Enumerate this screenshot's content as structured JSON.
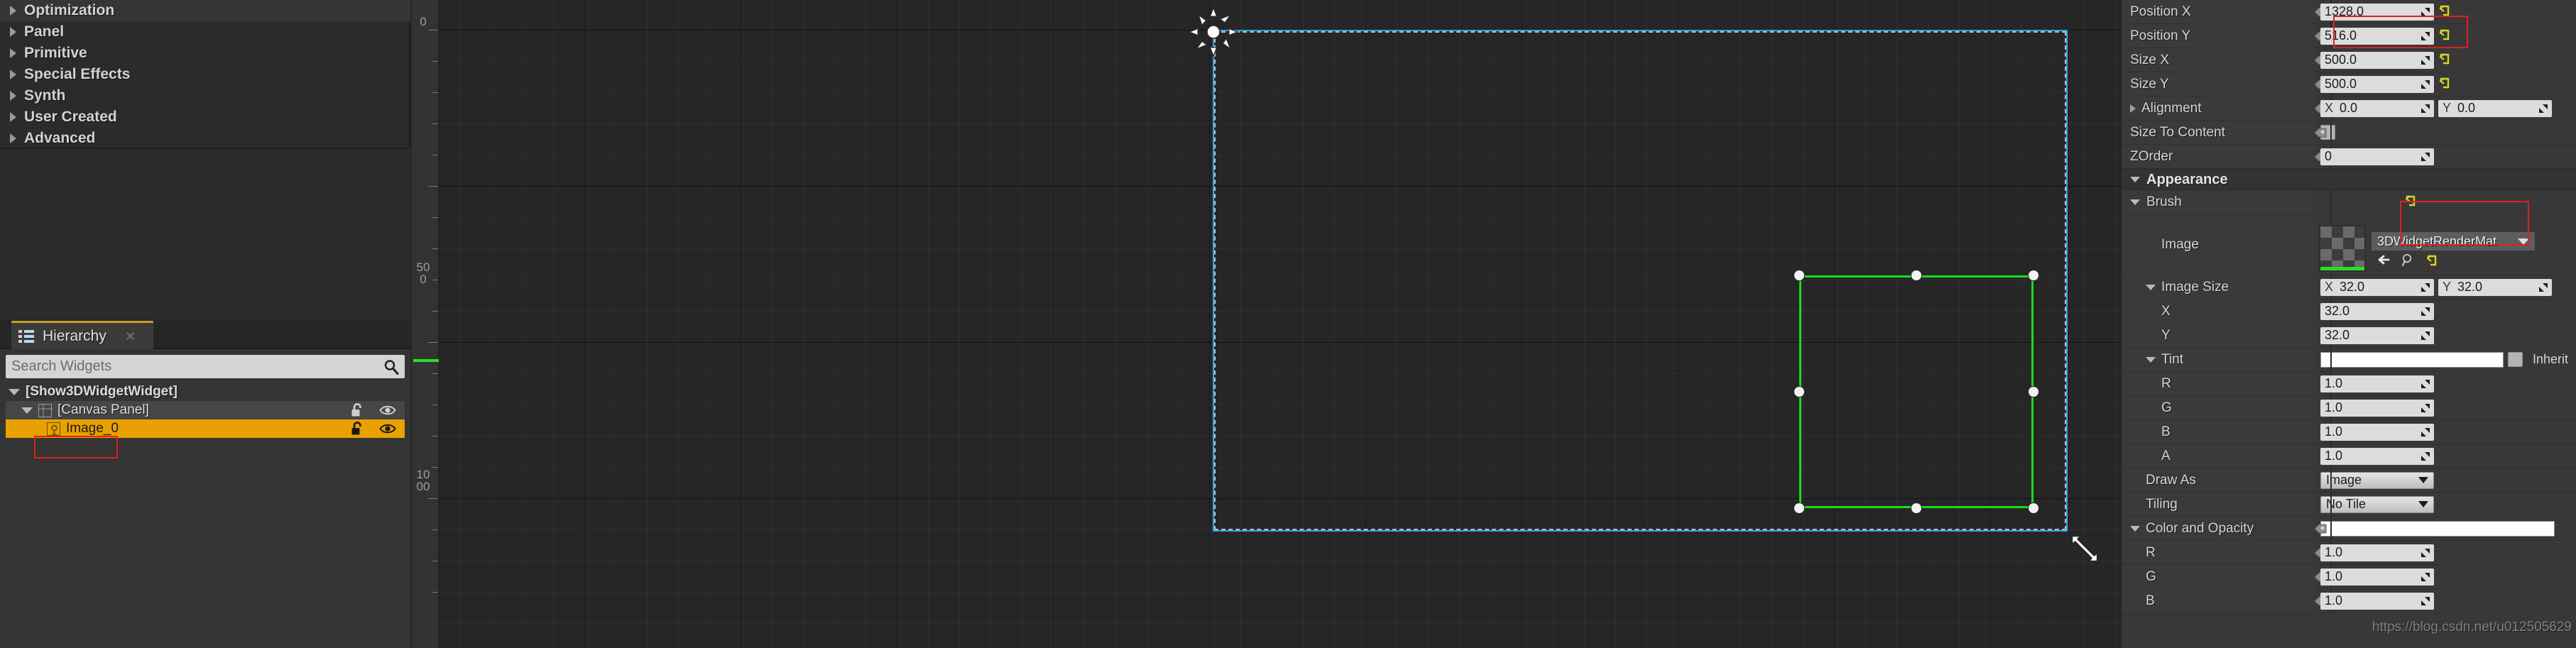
{
  "palette": {
    "items": [
      {
        "label": "Optimization",
        "icon": "chevron-right-icon"
      },
      {
        "label": "Panel",
        "icon": "chevron-right-icon"
      },
      {
        "label": "Primitive",
        "icon": "chevron-right-icon"
      },
      {
        "label": "Special Effects",
        "icon": "chevron-right-icon"
      },
      {
        "label": "Synth",
        "icon": "chevron-right-icon"
      },
      {
        "label": "User Created",
        "icon": "chevron-right-icon"
      },
      {
        "label": "Advanced",
        "icon": "chevron-right-icon"
      }
    ]
  },
  "hierarchy": {
    "tab_label": "Hierarchy",
    "tab_icon": "list-icon",
    "close_icon": "close-icon",
    "search": {
      "value": "",
      "placeholder": "Search Widgets",
      "icon": "search-icon"
    },
    "tree": [
      {
        "label": "[Show3DWidgetWidget]",
        "level": 0,
        "expander": "chevron-down-icon",
        "has_icons": false
      },
      {
        "label": "[Canvas Panel]",
        "level": 1,
        "expander": "chevron-down-icon",
        "has_icons": true,
        "lock_icon": "unlock-icon",
        "eye_icon": "eye-icon"
      },
      {
        "label": "Image_0",
        "level": 2,
        "expander": "none",
        "has_icons": true,
        "lock_icon": "unlock-icon",
        "eye_icon": "eye-icon",
        "selected": true
      }
    ]
  },
  "viewport": {
    "ruler": {
      "labels": [
        {
          "text": "0",
          "pos": 30
        },
        {
          "text": "500",
          "pos": 412
        },
        {
          "text": "1000",
          "pos": 680
        }
      ],
      "green_marker": true
    },
    "anchor_icon": "anchor-flower-icon",
    "resize_cursor_icon": "resize-diagonal-cursor-icon",
    "selection_color": "#29a9e0",
    "widget_rect_color": "#14e014"
  },
  "details": {
    "slot_rows": [
      {
        "name": "Position X",
        "indent": 0,
        "pin": true,
        "type": "num",
        "value": "1328.0",
        "revert": true
      },
      {
        "name": "Position Y",
        "indent": 0,
        "pin": true,
        "type": "num",
        "value": "516.0",
        "revert": true
      },
      {
        "name": "Size X",
        "indent": 0,
        "pin": true,
        "type": "num",
        "value": "500.0",
        "revert": true,
        "highlight": "top"
      },
      {
        "name": "Size Y",
        "indent": 0,
        "pin": true,
        "type": "num",
        "value": "500.0",
        "revert": true,
        "highlight": "bottom"
      },
      {
        "name": "Alignment",
        "indent": 0,
        "pin": true,
        "type": "vec2",
        "expander": "chevron-right-icon",
        "x_label": "X",
        "x_value": "0.0",
        "y_label": "Y",
        "y_value": "0.0"
      },
      {
        "name": "Size To Content",
        "indent": 0,
        "pin": true,
        "type": "checkbox",
        "checked": false
      },
      {
        "name": "ZOrder",
        "indent": 0,
        "pin": true,
        "type": "num",
        "value": "0"
      }
    ],
    "appearance": {
      "title": "Appearance",
      "brush_title": "Brush",
      "image_label": "Image",
      "asset_name": "3DWidgetRenderMat",
      "asset_browse_icon": "browse-icon",
      "asset_find_icon": "magnifier-icon",
      "asset_revert_icon": "revert-icon",
      "image_size": {
        "label": "Image Size",
        "x_label": "X",
        "x_value": "32.0",
        "y_label": "Y",
        "y_value": "32.0",
        "x_row": {
          "name": "X",
          "value": "32.0"
        },
        "y_row": {
          "name": "Y",
          "value": "32.0"
        }
      },
      "tint": {
        "label": "Tint",
        "color": "#ffffff",
        "inherit_label": "Inherit",
        "channels": [
          {
            "name": "R",
            "value": "1.0"
          },
          {
            "name": "G",
            "value": "1.0"
          },
          {
            "name": "B",
            "value": "1.0"
          },
          {
            "name": "A",
            "value": "1.0"
          }
        ]
      },
      "draw_as": {
        "label": "Draw As",
        "value": "Image"
      },
      "tiling": {
        "label": "Tiling",
        "value": "No Tile"
      }
    },
    "color_and_opacity": {
      "title": "Color and Opacity",
      "color": "#ffffff",
      "channels": [
        {
          "name": "R",
          "value": "1.0"
        },
        {
          "name": "G",
          "value": "1.0"
        },
        {
          "name": "B",
          "value": "1.0"
        }
      ]
    }
  },
  "watermark": "https://blog.csdn.net/u012505629"
}
